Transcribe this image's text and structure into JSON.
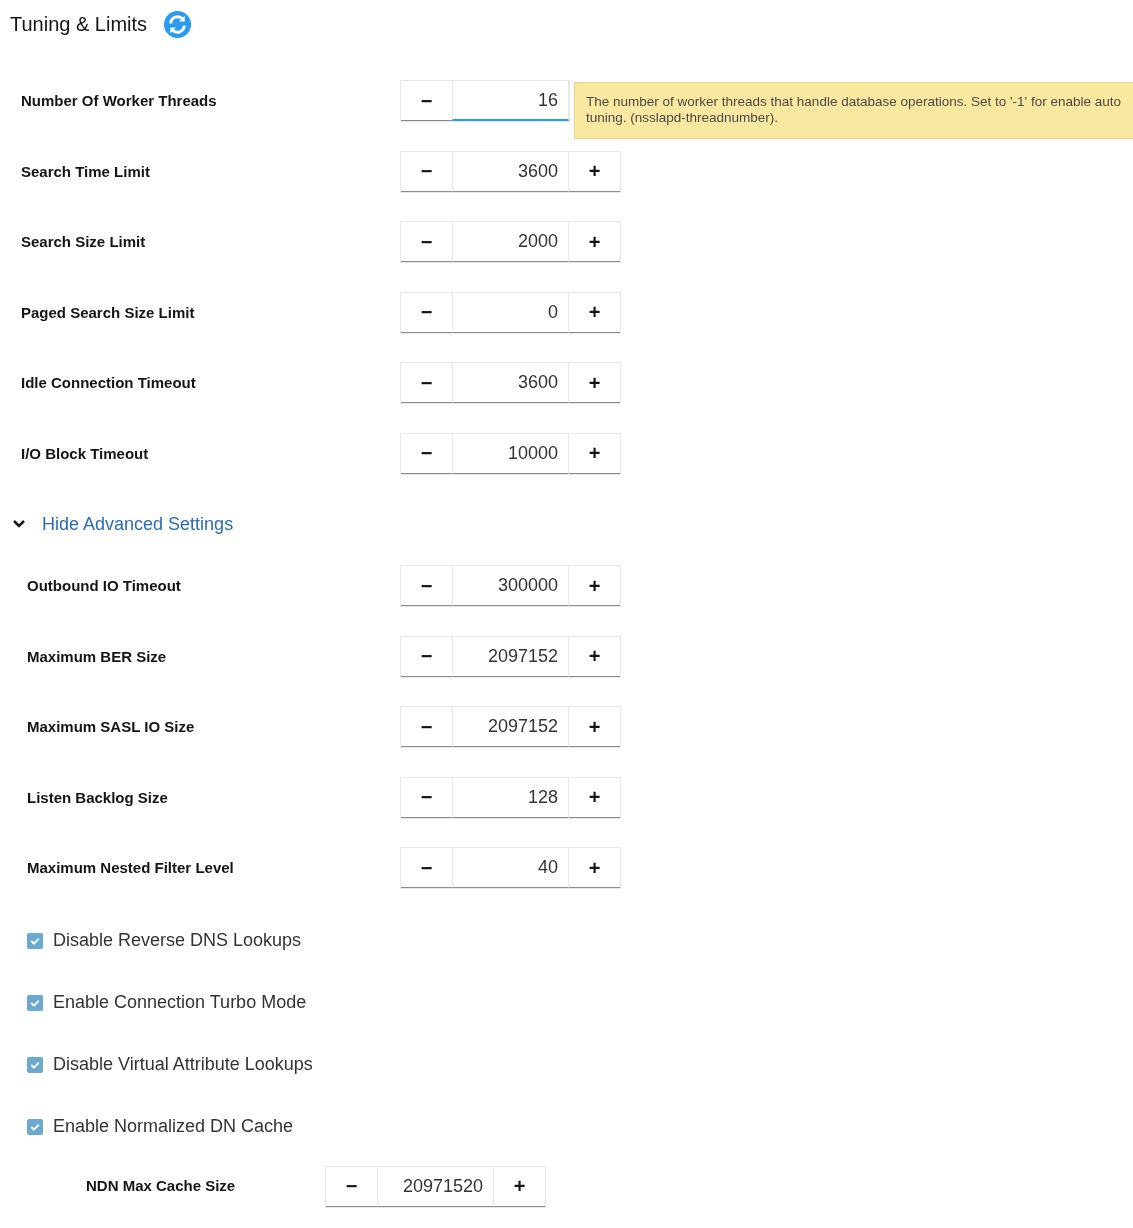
{
  "title": "Tuning & Limits",
  "settings": [
    {
      "label": "Number Of Worker Threads",
      "value": "16",
      "minus": "−",
      "focused": true
    },
    {
      "label": "Search Time Limit",
      "value": "3600",
      "minus": "−",
      "plus": "+",
      "focused": false
    },
    {
      "label": "Search Size Limit",
      "value": "2000",
      "minus": "−",
      "plus": "+",
      "focused": false
    },
    {
      "label": "Paged Search Size Limit",
      "value": "0",
      "minus": "−",
      "plus": "+",
      "focused": false
    },
    {
      "label": "Idle Connection Timeout",
      "value": "3600",
      "minus": "−",
      "plus": "+",
      "focused": false
    },
    {
      "label": "I/O Block Timeout",
      "value": "10000",
      "minus": "−",
      "plus": "+",
      "focused": false
    }
  ],
  "tooltip": {
    "text": "The number of worker threads that handle database operations.  Set to '-1' for enable auto tuning. (nsslapd-threadnumber)."
  },
  "advanced_toggle": {
    "label": "Hide Advanced Settings",
    "expanded": true
  },
  "advanced_settings": [
    {
      "label": "Outbound IO Timeout",
      "value": "300000",
      "minus": "−",
      "plus": "+",
      "focused": false
    },
    {
      "label": "Maximum BER Size",
      "value": "2097152",
      "minus": "−",
      "plus": "+",
      "focused": false
    },
    {
      "label": "Maximum SASL IO Size",
      "value": "2097152",
      "minus": "−",
      "plus": "+",
      "focused": false
    },
    {
      "label": "Listen Backlog Size",
      "value": "128",
      "minus": "−",
      "plus": "+",
      "focused": false
    },
    {
      "label": "Maximum Nested Filter Level",
      "value": "40",
      "minus": "−",
      "plus": "+",
      "focused": false
    }
  ],
  "checkboxes": [
    {
      "label": "Disable Reverse DNS Lookups",
      "checked": true
    },
    {
      "label": "Enable Connection Turbo Mode",
      "checked": true
    },
    {
      "label": "Disable Virtual Attribute Lookups",
      "checked": true
    },
    {
      "label": "Enable Normalized DN Cache",
      "checked": true
    }
  ],
  "ndn_setting": {
    "label": "NDN Max Cache Size",
    "value": "20971520",
    "minus": "−",
    "plus": "+",
    "focused": false
  }
}
